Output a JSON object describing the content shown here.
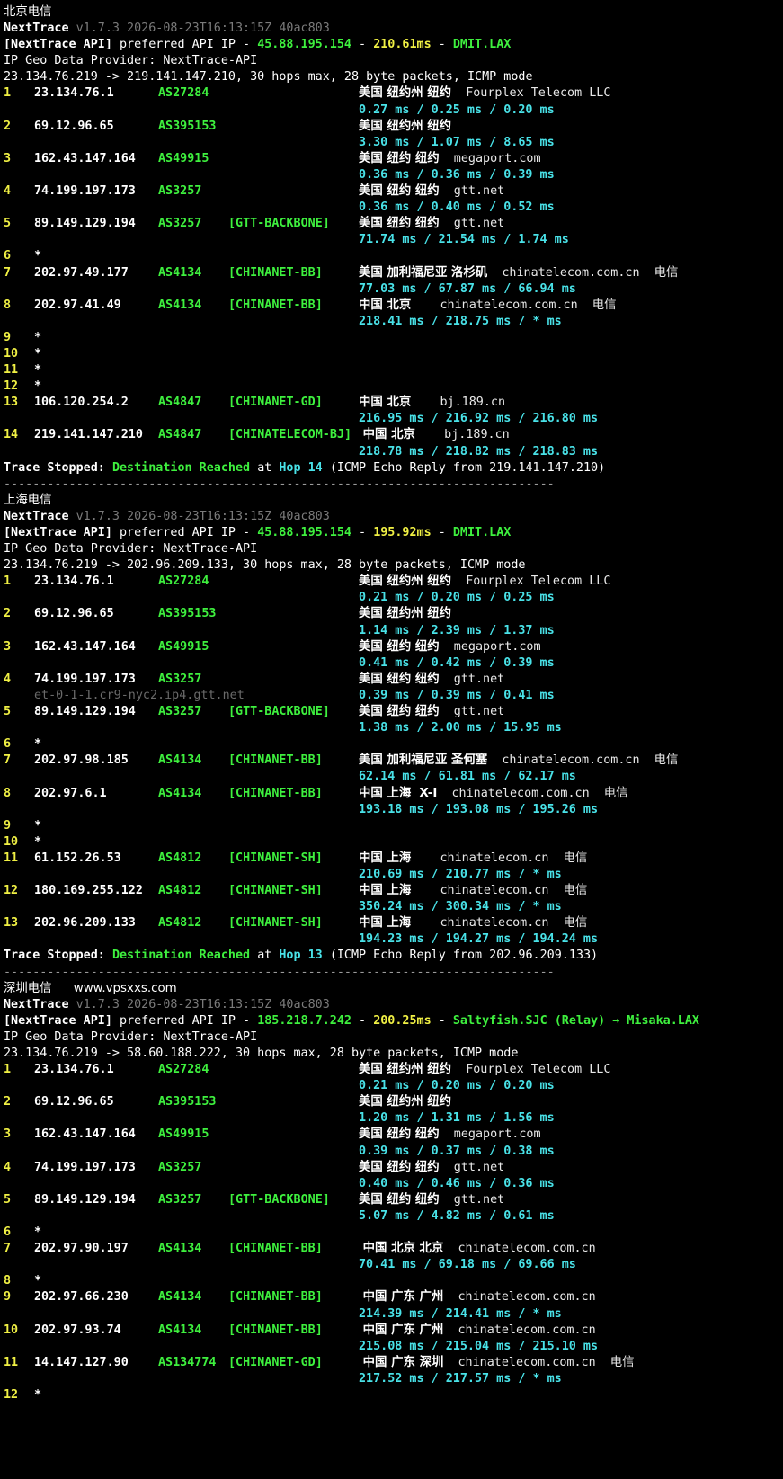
{
  "sections": [
    {
      "heading": "北京电信",
      "website": "",
      "version": "v1.7.3 2026-08-23T16:13:15Z 40ac803",
      "api_ip": "45.88.195.154",
      "api_latency": "210.61ms",
      "api_node": "DMIT.LAX",
      "geo_provider": "IP Geo Data Provider: NextTrace-API",
      "route": "23.134.76.219 -> 219.141.147.210, 30 hops max, 28 byte packets, ICMP mode",
      "hops": [
        {
          "n": "1",
          "ip": "23.134.76.1",
          "asn": "AS27284",
          "tag": "",
          "place": "美国 纽约州 纽约",
          "org": "Fourplex Telecom LLC",
          "rtt": "0.27 ms / 0.25 ms / 0.20 ms"
        },
        {
          "n": "2",
          "ip": "69.12.96.65",
          "asn": "AS395153",
          "tag": "",
          "place": "美国 纽约州 纽约",
          "org": "",
          "rtt": "3.30 ms / 1.07 ms / 8.65 ms"
        },
        {
          "n": "3",
          "ip": "162.43.147.164",
          "asn": "AS49915",
          "tag": "",
          "place": "美国 纽约 纽约",
          "org": "megaport.com",
          "rtt": "0.36 ms / 0.36 ms / 0.39 ms"
        },
        {
          "n": "4",
          "ip": "74.199.197.173",
          "asn": "AS3257",
          "tag": "",
          "place": "美国 纽约 纽约",
          "org": "gtt.net",
          "rtt": "0.36 ms / 0.40 ms / 0.52 ms"
        },
        {
          "n": "5",
          "ip": "89.149.129.194",
          "asn": "AS3257",
          "tag": "[GTT-BACKBONE]",
          "place": "美国 纽约 纽约",
          "org": "gtt.net",
          "rtt": "71.74 ms / 21.54 ms / 1.74 ms"
        },
        {
          "n": "6",
          "ip": "*",
          "asn": "",
          "tag": "",
          "place": "",
          "org": "",
          "rtt": ""
        },
        {
          "n": "7",
          "ip": "202.97.49.177",
          "asn": "AS4134",
          "tag": "[CHINANET-BB]",
          "place": "美国 加利福尼亚 洛杉矶",
          "org": "chinatelecom.com.cn  电信",
          "rtt": "77.03 ms / 67.87 ms / 66.94 ms"
        },
        {
          "n": "8",
          "ip": "202.97.41.49",
          "asn": "AS4134",
          "tag": "[CHINANET-BB]",
          "place": "中国 北京",
          "org": "  chinatelecom.com.cn  电信",
          "rtt": "218.41 ms / 218.75 ms / * ms"
        },
        {
          "n": "9",
          "ip": "*",
          "asn": "",
          "tag": "",
          "place": "",
          "org": "",
          "rtt": ""
        },
        {
          "n": "10",
          "ip": "*",
          "asn": "",
          "tag": "",
          "place": "",
          "org": "",
          "rtt": ""
        },
        {
          "n": "11",
          "ip": "*",
          "asn": "",
          "tag": "",
          "place": "",
          "org": "",
          "rtt": ""
        },
        {
          "n": "12",
          "ip": "*",
          "asn": "",
          "tag": "",
          "place": "",
          "org": "",
          "rtt": ""
        },
        {
          "n": "13",
          "ip": "106.120.254.2",
          "asn": "AS4847",
          "tag": "[CHINANET-GD]",
          "place": "中国 北京",
          "org": "  bj.189.cn",
          "rtt": "216.95 ms / 216.92 ms / 216.80 ms"
        },
        {
          "n": "14",
          "ip": "219.141.147.210",
          "asn": "AS4847",
          "tag": "[CHINATELECOM-BJ]",
          "place": " 中国 北京",
          "org": "  bj.189.cn",
          "rtt": "218.78 ms / 218.82 ms / 218.83 ms"
        }
      ],
      "stop_hop": "Hop 14",
      "stop_from": "(ICMP Echo Reply from 219.141.147.210)"
    },
    {
      "heading": "上海电信",
      "website": "",
      "version": "v1.7.3 2026-08-23T16:13:15Z 40ac803",
      "api_ip": "45.88.195.154",
      "api_latency": "195.92ms",
      "api_node": "DMIT.LAX",
      "geo_provider": "IP Geo Data Provider: NextTrace-API",
      "route": "23.134.76.219 -> 202.96.209.133, 30 hops max, 28 byte packets, ICMP mode",
      "hops": [
        {
          "n": "1",
          "ip": "23.134.76.1",
          "asn": "AS27284",
          "tag": "",
          "place": "美国 纽约州 纽约",
          "org": "Fourplex Telecom LLC",
          "rtt": "0.21 ms / 0.20 ms / 0.25 ms"
        },
        {
          "n": "2",
          "ip": "69.12.96.65",
          "asn": "AS395153",
          "tag": "",
          "place": "美国 纽约州 纽约",
          "org": "",
          "rtt": "1.14 ms / 2.39 ms / 1.37 ms"
        },
        {
          "n": "3",
          "ip": "162.43.147.164",
          "asn": "AS49915",
          "tag": "",
          "place": "美国 纽约 纽约",
          "org": "megaport.com",
          "rtt": "0.41 ms / 0.42 ms / 0.39 ms"
        },
        {
          "n": "4",
          "ip": "74.199.197.173",
          "asn": "AS3257",
          "tag": "",
          "place": "美国 纽约 纽约",
          "org": "gtt.net",
          "rtt": "0.39 ms / 0.39 ms / 0.41 ms",
          "rdns": "et-0-1-1.cr9-nyc2.ip4.gtt.net"
        },
        {
          "n": "5",
          "ip": "89.149.129.194",
          "asn": "AS3257",
          "tag": "[GTT-BACKBONE]",
          "place": "美国 纽约 纽约",
          "org": "gtt.net",
          "rtt": "1.38 ms / 2.00 ms / 15.95 ms"
        },
        {
          "n": "6",
          "ip": "*",
          "asn": "",
          "tag": "",
          "place": "",
          "org": "",
          "rtt": ""
        },
        {
          "n": "7",
          "ip": "202.97.98.185",
          "asn": "AS4134",
          "tag": "[CHINANET-BB]",
          "place": "美国 加利福尼亚 圣何塞",
          "org": "chinatelecom.com.cn  电信",
          "rtt": "62.14 ms / 61.81 ms / 62.17 ms"
        },
        {
          "n": "8",
          "ip": "202.97.6.1",
          "asn": "AS4134",
          "tag": "[CHINANET-BB]",
          "place": "中国 上海  X-I",
          "org": "chinatelecom.com.cn  电信",
          "rtt": "193.18 ms / 193.08 ms / 195.26 ms"
        },
        {
          "n": "9",
          "ip": "*",
          "asn": "",
          "tag": "",
          "place": "",
          "org": "",
          "rtt": ""
        },
        {
          "n": "10",
          "ip": "*",
          "asn": "",
          "tag": "",
          "place": "",
          "org": "",
          "rtt": ""
        },
        {
          "n": "11",
          "ip": "61.152.26.53",
          "asn": "AS4812",
          "tag": "[CHINANET-SH]",
          "place": "中国 上海",
          "org": "  chinatelecom.cn  电信",
          "rtt": "210.69 ms / 210.77 ms / * ms"
        },
        {
          "n": "12",
          "ip": "180.169.255.122",
          "asn": "AS4812",
          "tag": "[CHINANET-SH]",
          "place": "中国 上海",
          "org": "  chinatelecom.cn  电信",
          "rtt": "350.24 ms / 300.34 ms / * ms"
        },
        {
          "n": "13",
          "ip": "202.96.209.133",
          "asn": "AS4812",
          "tag": "[CHINANET-SH]",
          "place": "中国 上海",
          "org": "  chinatelecom.cn  电信",
          "rtt": "194.23 ms / 194.27 ms / 194.24 ms"
        }
      ],
      "stop_hop": "Hop 13",
      "stop_from": "(ICMP Echo Reply from 202.96.209.133)"
    },
    {
      "heading": "深圳电信",
      "website": "www.vpsxxs.com",
      "version": "v1.7.3 2026-08-23T16:13:15Z 40ac803",
      "api_ip": "185.218.7.242",
      "api_latency": "200.25ms",
      "api_node": "Saltyfish.SJC (Relay) → Misaka.LAX",
      "geo_provider": "IP Geo Data Provider: NextTrace-API",
      "route": "23.134.76.219 -> 58.60.188.222, 30 hops max, 28 byte packets, ICMP mode",
      "hops": [
        {
          "n": "1",
          "ip": "23.134.76.1",
          "asn": "AS27284",
          "tag": "",
          "place": "美国 纽约州 纽约",
          "org": "Fourplex Telecom LLC",
          "rtt": "0.21 ms / 0.20 ms / 0.20 ms"
        },
        {
          "n": "2",
          "ip": "69.12.96.65",
          "asn": "AS395153",
          "tag": "",
          "place": "美国 纽约州 纽约",
          "org": "",
          "rtt": "1.20 ms / 1.31 ms / 1.56 ms"
        },
        {
          "n": "3",
          "ip": "162.43.147.164",
          "asn": "AS49915",
          "tag": "",
          "place": "美国 纽约 纽约",
          "org": "megaport.com",
          "rtt": "0.39 ms / 0.37 ms / 0.38 ms"
        },
        {
          "n": "4",
          "ip": "74.199.197.173",
          "asn": "AS3257",
          "tag": "",
          "place": "美国 纽约 纽约",
          "org": "gtt.net",
          "rtt": "0.40 ms / 0.46 ms / 0.36 ms"
        },
        {
          "n": "5",
          "ip": "89.149.129.194",
          "asn": "AS3257",
          "tag": "[GTT-BACKBONE]",
          "place": "美国 纽约 纽约",
          "org": "gtt.net",
          "rtt": "5.07 ms / 4.82 ms / 0.61 ms"
        },
        {
          "n": "6",
          "ip": "*",
          "asn": "",
          "tag": "",
          "place": "",
          "org": "",
          "rtt": ""
        },
        {
          "n": "7",
          "ip": "202.97.90.197",
          "asn": "AS4134",
          "tag": "[CHINANET-BB]",
          "place": " 中国 北京 北京",
          "org": "chinatelecom.com.cn",
          "rtt": "70.41 ms / 69.18 ms / 69.66 ms"
        },
        {
          "n": "8",
          "ip": "*",
          "asn": "",
          "tag": "",
          "place": "",
          "org": "",
          "rtt": ""
        },
        {
          "n": "9",
          "ip": "202.97.66.230",
          "asn": "AS4134",
          "tag": "[CHINANET-BB]",
          "place": " 中国 广东 广州",
          "org": "chinatelecom.com.cn",
          "rtt": "214.39 ms / 214.41 ms / * ms"
        },
        {
          "n": "10",
          "ip": "202.97.93.74",
          "asn": "AS4134",
          "tag": "[CHINANET-BB]",
          "place": " 中国 广东 广州",
          "org": "chinatelecom.com.cn",
          "rtt": "215.08 ms / 215.04 ms / 215.10 ms"
        },
        {
          "n": "11",
          "ip": "14.147.127.90",
          "asn": "AS134774",
          "tag": "[CHINANET-GD]",
          "place": " 中国 广东 深圳",
          "org": "chinatelecom.com.cn  电信",
          "rtt": "217.52 ms / 217.57 ms / * ms"
        },
        {
          "n": "12",
          "ip": "*",
          "asn": "",
          "tag": "",
          "place": "",
          "org": "",
          "rtt": ""
        }
      ],
      "stop_hop": "",
      "stop_from": ""
    }
  ],
  "labels": {
    "tool": "NextTrace",
    "api_prefix": "[NextTrace API]",
    "api_text": "preferred API IP",
    "dash": "-",
    "stop_prefix": "Trace Stopped:",
    "stop_reached": "Destination Reached",
    "stop_at": "at",
    "separator": "----------------------------------------------------------------------------"
  },
  "colors": {
    "background": "#000000",
    "green": "#3ef03e",
    "yellow": "#f0f044",
    "cyan": "#49e2e8",
    "gray": "#7a7a7a"
  }
}
